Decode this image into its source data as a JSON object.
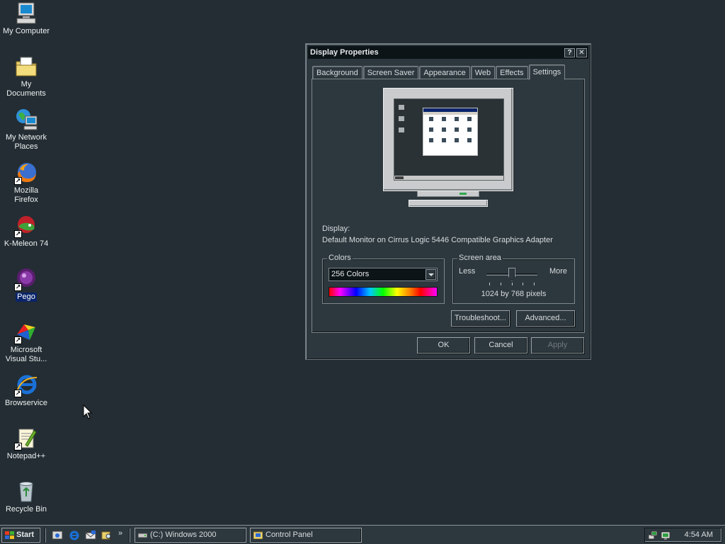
{
  "desktop": {
    "icons": [
      {
        "label": "My Computer"
      },
      {
        "label": "My Documents"
      },
      {
        "label": "My Network Places"
      },
      {
        "label": "Mozilla Firefox"
      },
      {
        "label": "K-Meleon 74"
      },
      {
        "label": "Pego"
      },
      {
        "label": "Microsoft Visual Stu..."
      },
      {
        "label": "Browservice"
      },
      {
        "label": "Notepad++"
      },
      {
        "label": "Recycle Bin"
      }
    ]
  },
  "dialog": {
    "title": "Display Properties",
    "help_label": "?",
    "close_label": "✕",
    "tabs": [
      {
        "label": "Background"
      },
      {
        "label": "Screen Saver"
      },
      {
        "label": "Appearance"
      },
      {
        "label": "Web"
      },
      {
        "label": "Effects"
      },
      {
        "label": "Settings"
      }
    ],
    "active_tab": "Settings",
    "display_caption": "Display:",
    "display_value": "Default Monitor on Cirrus Logic 5446 Compatible Graphics Adapter",
    "colors": {
      "legend": "Colors",
      "selected": "256 Colors"
    },
    "screen_area": {
      "legend": "Screen area",
      "less_label": "Less",
      "more_label": "More",
      "resolution": "1024 by 768 pixels",
      "slider_fraction": 0.5
    },
    "buttons": {
      "troubleshoot": "Troubleshoot...",
      "advanced": "Advanced...",
      "ok": "OK",
      "cancel": "Cancel",
      "apply": "Apply"
    }
  },
  "taskbar": {
    "start_label": "Start",
    "quick_launch_more": "»",
    "tasks": [
      {
        "label": "(C:) Windows 2000"
      },
      {
        "label": "Control Panel"
      }
    ],
    "clock": "4:54 AM"
  },
  "colors": {
    "desktop_bg": "#232d33",
    "window_bg": "#2d383e",
    "titlebar_bg": "#0d1418",
    "selection": "#0a246a"
  }
}
